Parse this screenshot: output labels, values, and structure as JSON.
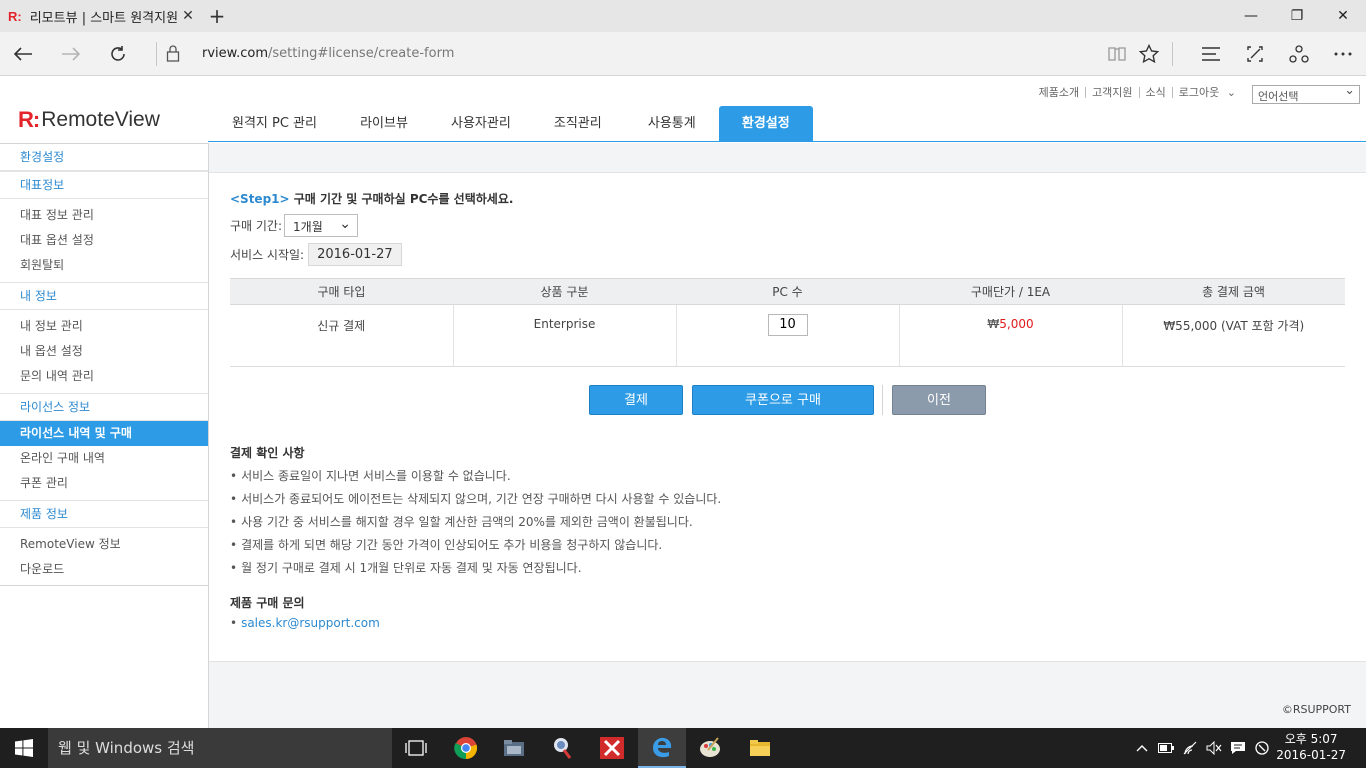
{
  "browser": {
    "tab_favicon": "R:",
    "tab_title": "리모트뷰 | 스마트 원격지원",
    "tab_close": "✕",
    "new_tab": "+",
    "url_host": "rview.com",
    "url_path": "/setting#license/create-form",
    "window_controls": [
      "—",
      "❐",
      "✕"
    ]
  },
  "header": {
    "util_links": [
      "제품소개",
      "고객지원",
      "소식",
      "로그아웃"
    ],
    "language_select": "언어선택",
    "logo_mark": "R:",
    "logo_text": "RemoteView",
    "nav": [
      {
        "label": "원격지 PC 관리",
        "active": false
      },
      {
        "label": "라이브뷰",
        "active": false
      },
      {
        "label": "사용자관리",
        "active": false
      },
      {
        "label": "조직관리",
        "active": false
      },
      {
        "label": "사용통계",
        "active": false
      },
      {
        "label": "환경설정",
        "active": true
      }
    ]
  },
  "sidebar": {
    "top": "환경설정",
    "groups": [
      {
        "head": "대표정보",
        "items": [
          "대표 정보 관리",
          "대표 옵션 설정",
          "회원탈퇴"
        ]
      },
      {
        "head": "내 정보",
        "items": [
          "내 정보 관리",
          "내 옵션 설정",
          "문의 내역 관리"
        ]
      },
      {
        "head": "라이선스 정보",
        "items": [
          "라이선스 내역 및 구매",
          "온라인 구매 내역",
          "쿠폰 관리"
        ]
      },
      {
        "head": "제품 정보",
        "items": [
          "RemoteView 정보",
          "다운로드"
        ]
      }
    ],
    "active_item": "라이선스 내역 및 구매"
  },
  "form": {
    "step_tag": "<Step1>",
    "step_text": " 구매 기간 및 구매하실 PC수를 선택하세요.",
    "period_label": "구매 기간:",
    "period_value": "1개월",
    "start_label": "서비스 시작일:",
    "start_value": "2016-01-27"
  },
  "table": {
    "headers": [
      "구매 타입",
      "상품 구분",
      "PC 수",
      "구매단가 / 1EA",
      "총 결제 금액"
    ],
    "row": {
      "type": "신규 결제",
      "product": "Enterprise",
      "pc_count": "10",
      "unit_price_old": "₩",
      "unit_price": "5,000",
      "total": "₩55,000 (VAT 포함 가격)"
    }
  },
  "buttons": {
    "pay": "결제",
    "coupon": "쿠폰으로 구매",
    "prev": "이전"
  },
  "notice": {
    "title": "결제 확인 사항",
    "items": [
      "서비스 종료일이 지나면 서비스를 이용할 수 없습니다.",
      "서비스가 종료되어도 에이전트는 삭제되지 않으며, 기간 연장 구매하면 다시 사용할 수 있습니다.",
      "사용 기간 중 서비스를 해지할 경우 일할 계산한 금액의 20%를 제외한 금액이 환불됩니다.",
      "결제를 하게 되면 해당 기간 동안 가격이 인상되어도 추가 비용을 청구하지 않습니다.",
      "월 정기 구매로 결제 시 1개월 단위로 자동 결제 및 자동 연장됩니다."
    ],
    "inquiry_title": "제품 구매 문의",
    "inquiry_email": "sales.kr@rsupport.com",
    "bullet": "•"
  },
  "footer": {
    "copyright": "©RSUPPORT"
  },
  "taskbar": {
    "search_placeholder": "웹 및 Windows 검색",
    "clock_time": "오후 5:07",
    "clock_date": "2016-01-27"
  },
  "colors": {
    "brand_red": "#e4242b",
    "accent_blue": "#2d9be5",
    "price_red": "#e01b1b"
  }
}
